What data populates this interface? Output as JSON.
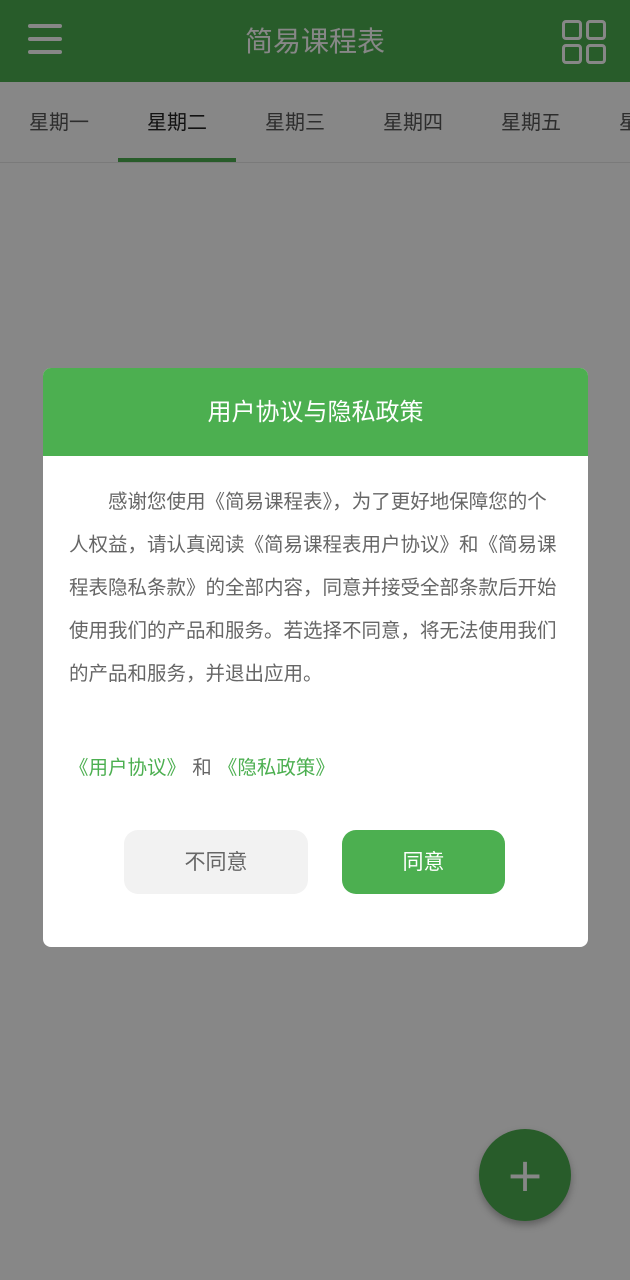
{
  "app_title": "简易课程表",
  "icons": {
    "menu": "menu-icon",
    "grid": "grid-icon",
    "add": "plus-icon"
  },
  "colors": {
    "primary": "#4caf50",
    "overlay": "rgba(0,0,0,0.47)"
  },
  "tabs": [
    {
      "label": "星期一",
      "active": false
    },
    {
      "label": "星期二",
      "active": true
    },
    {
      "label": "星期三",
      "active": false
    },
    {
      "label": "星期四",
      "active": false
    },
    {
      "label": "星期五",
      "active": false
    },
    {
      "label": "星期六",
      "active": false
    }
  ],
  "fab": {
    "label": "+"
  },
  "dialog": {
    "title": "用户协议与隐私政策",
    "body": "感谢您使用《简易课程表》，为了更好地保障您的个人权益，请认真阅读《简易课程表用户协议》和《简易课程表隐私条款》的全部内容，同意并接受全部条款后开始使用我们的产品和服务。若选择不同意，将无法使用我们的产品和服务，并退出应用。",
    "link_user_agreement": "《用户协议》",
    "link_joiner": " 和 ",
    "link_privacy_policy": "《隐私政策》",
    "disagree_label": "不同意",
    "agree_label": "同意"
  }
}
